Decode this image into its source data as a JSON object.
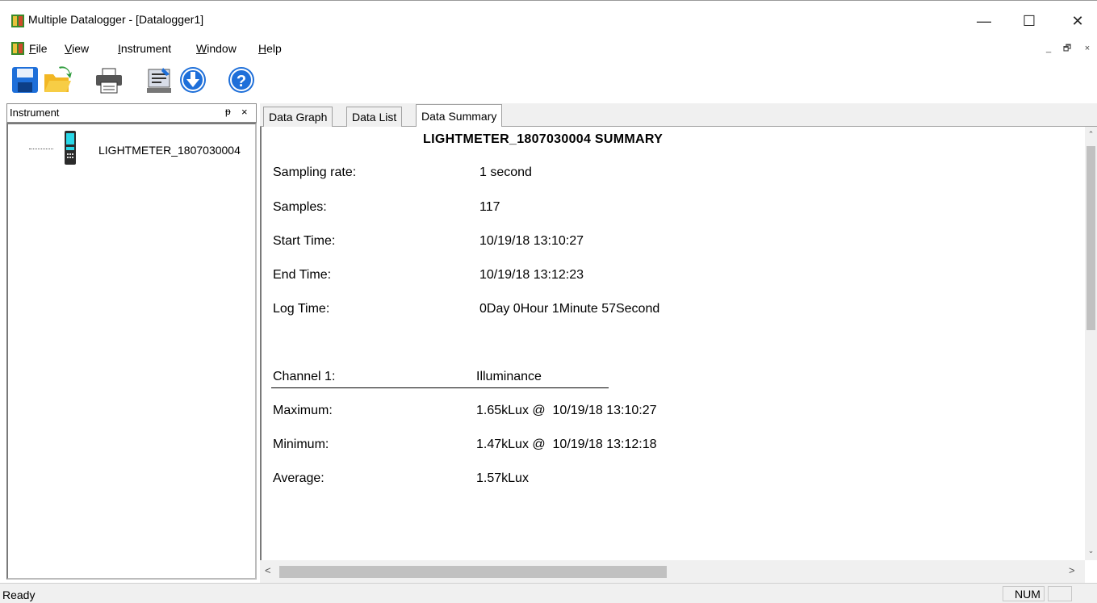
{
  "window": {
    "title": "Multiple Datalogger - [Datalogger1]",
    "minimize_glyph": "—",
    "maximize_glyph": "☐",
    "close_glyph": "✕"
  },
  "menu": {
    "items": [
      {
        "label": "File",
        "accel": "F"
      },
      {
        "label": "View",
        "accel": "V"
      },
      {
        "label": "Instrument",
        "accel": "I"
      },
      {
        "label": "Window",
        "accel": "W"
      },
      {
        "label": "Help",
        "accel": "H"
      }
    ],
    "mdi_minimize": "_",
    "mdi_restore": "🗗",
    "mdi_close": "×"
  },
  "toolbar": {
    "buttons": [
      "save-icon",
      "open-folder-icon",
      "print-icon",
      "settings-icon",
      "download-icon",
      "help-icon"
    ]
  },
  "instrument_panel": {
    "title": "Instrument",
    "pin_glyph": "ᵽ",
    "close_glyph": "×",
    "items": [
      {
        "label": "LIGHTMETER_1807030004"
      }
    ]
  },
  "tabs": [
    {
      "label": "Data Graph",
      "active": false
    },
    {
      "label": "Data List",
      "active": false
    },
    {
      "label": "Data Summary",
      "active": true
    }
  ],
  "summary": {
    "title": "LIGHTMETER_1807030004 SUMMARY",
    "rows": [
      {
        "label": "Sampling rate:",
        "value": "1 second"
      },
      {
        "label": "Samples:",
        "value": "117"
      },
      {
        "label": "Start Time:",
        "value": "10/19/18 13:10:27"
      },
      {
        "label": "End Time:",
        "value": "10/19/18 13:12:23"
      },
      {
        "label": "Log Time:",
        "value": "0Day 0Hour 1Minute 57Second"
      }
    ],
    "channel": {
      "label": "Channel 1:",
      "value": "Illuminance"
    },
    "stats": [
      {
        "label": "Maximum:",
        "value": "1.65kLux @  10/19/18 13:10:27"
      },
      {
        "label": "Minimum:",
        "value": "1.47kLux @  10/19/18 13:12:18"
      },
      {
        "label": "Average:",
        "value": "1.57kLux"
      }
    ]
  },
  "statusbar": {
    "text": "Ready",
    "num": "NUM"
  },
  "colors": {
    "accent_blue": "#1e6fd9",
    "window_bg": "#ffffff",
    "chrome_bg": "#f0f0f0"
  }
}
